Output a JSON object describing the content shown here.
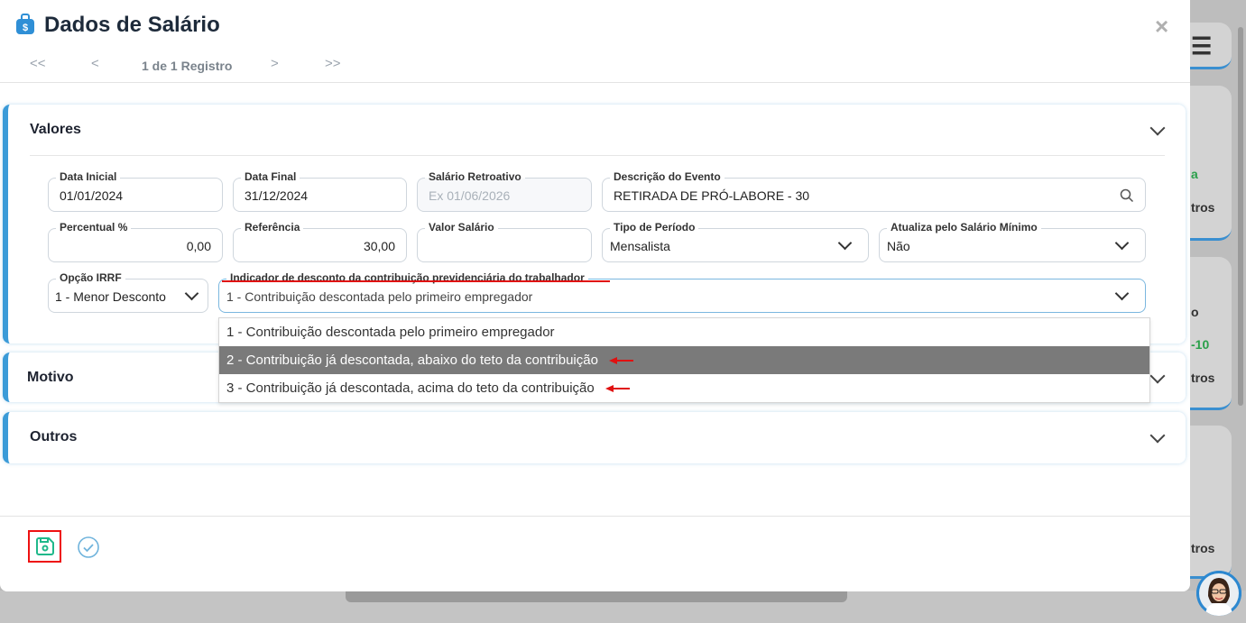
{
  "modal": {
    "title": "Dados de Salário",
    "close": "×"
  },
  "pager": {
    "first": "<<",
    "prev": "<",
    "text": "1 de 1 Registro",
    "next": ">",
    "last": ">>"
  },
  "sections": {
    "valores": "Valores",
    "motivo": "Motivo",
    "outros": "Outros"
  },
  "fields": {
    "data_inicial": {
      "label": "Data Inicial",
      "value": "01/01/2024"
    },
    "data_final": {
      "label": "Data Final",
      "value": "31/12/2024"
    },
    "salario_retroativo": {
      "label": "Salário Retroativo",
      "placeholder": "Ex 01/06/2026"
    },
    "descricao_evento": {
      "label": "Descrição do Evento",
      "value": "RETIRADA DE PRÓ-LABORE - 30"
    },
    "percentual": {
      "label": "Percentual %",
      "value": "0,00"
    },
    "referencia": {
      "label": "Referência",
      "value": "30,00"
    },
    "valor_salario": {
      "label": "Valor Salário",
      "value": ""
    },
    "tipo_periodo": {
      "label": "Tipo de Período",
      "value": "Mensalista"
    },
    "atualiza_salario_minimo": {
      "label": "Atualiza pelo Salário Mínimo",
      "value": "Não"
    },
    "opcao_irrf": {
      "label": "Opção IRRF",
      "value": "1 - Menor Desconto"
    },
    "indicador_desconto": {
      "label": "Indicador de desconto da contribuição previdenciária do trabalhador",
      "value": "1 - Contribuição descontada pelo primeiro empregador"
    }
  },
  "dropdown": {
    "options": [
      "1 - Contribuição descontada pelo primeiro empregador",
      "2 - Contribuição já descontada, abaixo do teto da contribuição",
      "3 - Contribuição já descontada, acima do teto da contribuição"
    ]
  },
  "background": {
    "card1_text": "a",
    "card1_text2": "tros",
    "card2_text": "o",
    "card2_val": "-10",
    "card2_text2": "tros",
    "card3_text": "tros"
  },
  "colors": {
    "accent": "#3b9bd8",
    "annotation": "#e01010",
    "selected_option": "#7a7a7a",
    "save_icon": "#1fb88a"
  }
}
